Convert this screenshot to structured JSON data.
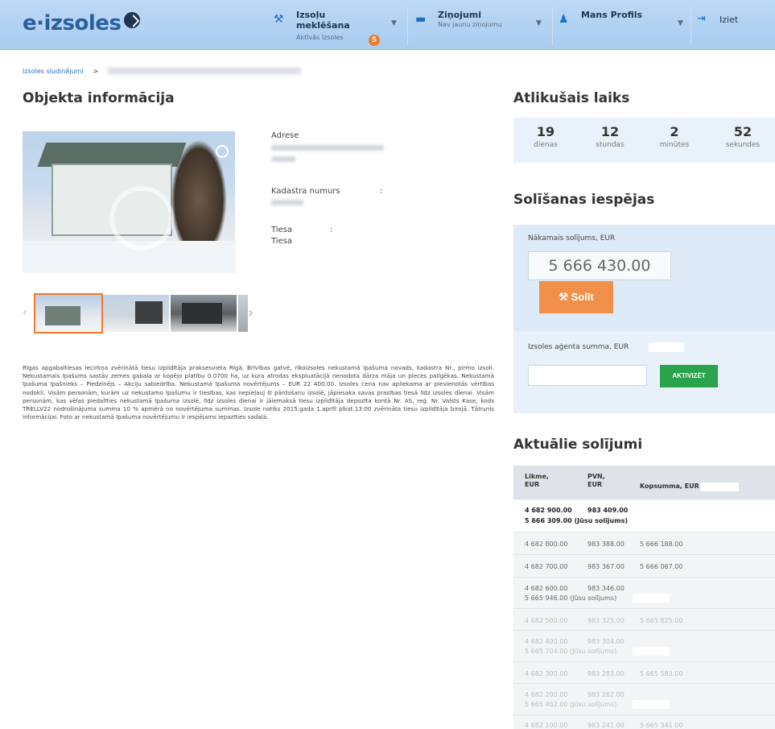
{
  "header": {
    "logo": "e·izsoles",
    "nav": [
      {
        "title": "Izsoļu meklēšana",
        "subtitle": "Aktīvās izsoles",
        "badge": "5"
      },
      {
        "title": "Ziņojumi",
        "subtitle": "Nav jaunu ziņojumu"
      },
      {
        "title": "Mans Profils",
        "subtitle": ""
      },
      {
        "title": "Iziet"
      }
    ]
  },
  "breadcrumb": {
    "first": "Izsoles sludinājumi",
    "separator": ">"
  },
  "object_info": {
    "title": "Objekta informācija",
    "address_label": "Adrese",
    "cadastre_label": "Kadastra numurs",
    "court_label": "Tiesa",
    "court_value": "Tiesa"
  },
  "description": "Rīgas apgabaltiesas Iecirkņa zvērinātā tiesu izpildītāja praksesvieta Rīgā, Brīvības gatvē, rīkoizsoles nekustamā īpašuma novads, kadastra Nr., pirmo izsoli. Nekustamais īpašums sastāv zemes gabala ar kopējo platību 0.0700 ha, uz kura atrodas ekspluatācijā nenodota dārza māja un pieces palīgēkas. Nekustamā īpašuma īpašnieks – Piedzinējs – Akciju sabiedrība. Nekustamā īpašuma novērtējums – EUR 22 400.00. Izsoles cena nav apliekama ar pievienotās vērtības nodokli. Visām personām, kurām uz nekustamo īpašumu ir tiesības, kas nepieļauj šī pārdošanu izsolē, jāpiesaka savas prasības tiesā līdz izsoles dienai. Visām personām, kas vēlas piedalīties nekustamā īpašuma izsolē, līdz izsoles dienai ir jāiemaksā tiesu izpildītāja depozīta kontā Nr. AS, reģ. Nr. Valsts Kase, kods TRELLV22 nodrošinājuma summa 10 % apmērā no novērtējuma summas. Izsole notiks 2015.gada 1.aprīlī plkst.13:00 zvērināta tiesu izpildītāja birojā. Tālrunis informācijai. Foto ar nekustamā īpašuma novērtējumu ir iespējams iepazīties sadaļā.",
  "timer": {
    "title": "Atlikušais laiks",
    "cells": [
      {
        "value": "19",
        "unit": "dienas"
      },
      {
        "value": "12",
        "unit": "stundas"
      },
      {
        "value": "2",
        "unit": "minūtes"
      },
      {
        "value": "52",
        "unit": "sekundes"
      }
    ]
  },
  "bidding": {
    "title": "Solīšanas iespējas",
    "next_label": "Nākamais solījums, EUR",
    "next_value": "5 666 430.00",
    "bid_button": "Solīt",
    "agent_label": "Izsoles aģenta summa, EUR",
    "activate_button": "AKTIVIZĒT"
  },
  "bids": {
    "title": "Aktuālie solījumi",
    "headers": {
      "amount": "Likme, EUR",
      "vat": "PVN, EUR",
      "total": "Kopsumma, EUR"
    },
    "rows": [
      {
        "amount": "4 682 900.00",
        "vat": "983 409.00",
        "total": "5 666 309.00 (Jūsu solījums)"
      },
      {
        "amount": "4 682 800.00",
        "vat": "983 388.00",
        "total": "5 666 188.00"
      },
      {
        "amount": "4 682 700.00",
        "vat": "983 367.00",
        "total": "5 666 067.00"
      },
      {
        "amount": "4 682 600.00",
        "vat": "983 346.00",
        "total": "5 665 946.00 (Jūsu solījums)"
      },
      {
        "amount": "4 682 500.00",
        "vat": "983 325.00",
        "total": "5 665 825.00"
      },
      {
        "amount": "4 682 400.00",
        "vat": "983 304.00",
        "total": "5 665 704.00 (Jūsu solījums)"
      },
      {
        "amount": "4 682 300.00",
        "vat": "983 283.00",
        "total": "5 665 583.00"
      },
      {
        "amount": "4 682 200.00",
        "vat": "983 262.00",
        "total": "5 665 462.00 (Jūsu solījums)"
      },
      {
        "amount": "4 682 100.00",
        "vat": "983 241.00",
        "total": "5 665 341.00"
      }
    ]
  }
}
